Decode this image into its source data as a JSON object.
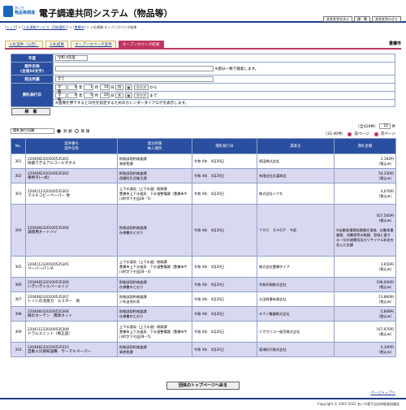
{
  "header": {
    "logo_line1": "あいち",
    "logo_line2": "物品等調達",
    "title": "電子調達共同システム（物品等）",
    "font_buttons": [
      "文字文字大きく",
      "標　準",
      "文字文字小さく"
    ]
  },
  "breadcrumb": {
    "items": [
      "トップ",
      "入札情報サービス（団体選択）",
      "豊橋市"
    ],
    "current": "入札情報-オープンカウンタ結果"
  },
  "tabs": [
    "入札案件（公告）",
    "入札結果",
    "オープンカウンタ案件",
    "オープンカウンタ結果"
  ],
  "city": "豊橋市",
  "form": {
    "year_label": "年度",
    "year_value": "令和 4年度",
    "subject_label": "案件名称",
    "subject_sub": "(全角50文字)",
    "subject_note": "※部分一致で検索します。",
    "dept_label": "発注所属",
    "dept_value": "全て",
    "date_label": "開札執行日",
    "from_era": "令和",
    "from_year": "4",
    "from_month": "1",
    "from_day": "10",
    "from_weekday": "月",
    "to_era": "令和",
    "to_year": "4",
    "to_month": "4",
    "to_day": "20",
    "to_weekday": "水",
    "unit_year": "年",
    "unit_month": "月",
    "unit_day": "日",
    "calendar_label": "クリア",
    "from_suffix": "から",
    "to_suffix": "まで",
    "date_note": "※画像を押下すると日付を指定するためのカレンダーダイアログを表示します。",
    "search_button": "検　索"
  },
  "sort": {
    "select_value": "開札執行日順",
    "asc_label": "昇 順",
    "desc_label": "降 順"
  },
  "pager": {
    "total": "（全429件）",
    "per_page": "10",
    "per_page_suffix": "件",
    "range": "（31-40件）",
    "prev": "前ページ",
    "next": "次ページ"
  },
  "table": {
    "headers": [
      "No.",
      "案件番号\n案件名称",
      "発注所属\n納入場所",
      "開札執行日",
      "業者名",
      "落札金額"
    ],
    "rows": [
      {
        "no": "301",
        "number": "2204082320100535301",
        "name": "除菌できるアルコールタオル",
        "dept": "財務部契約検査課",
        "place": "資産税課",
        "date": "令和 4年　4月20日",
        "vendor": "原田株式会社",
        "amount": "2,183円",
        "tax": "（税込み）"
      },
      {
        "no": "302",
        "number": "2204082320100535302",
        "name": "車椅子(一式)",
        "dept": "財務部契約検査課",
        "place": "保健所生活衛生課",
        "date": "令和 4年　4月20日",
        "vendor": "有限会社丸富商会",
        "amount": "54,230円",
        "tax": "（税込み）"
      },
      {
        "no": "303",
        "number": "2204112320100535303",
        "name": "マルチコピーペーパー 他",
        "dept": "上下水道局（上下水道）総務課",
        "place": "豊橋市上下水道局　下水道整備課（豊橋市牛川町字下モ田28－5）",
        "date": "令和 4年　4月20日",
        "vendor": "株式会社イクモ",
        "amount": "4,076円",
        "tax": "（税込み）"
      },
      {
        "no": "304",
        "number": "2204082320100535304",
        "name": "調達用オートバイ",
        "dept": "財務部契約検査課",
        "place": "仕様書のとおり",
        "date": "令和 4年　4月20日",
        "vendor": "ＹＯＵ　ＳＨＯＰ　今泉",
        "amount": "457,500円",
        "tax": "（税込み）",
        "note": "※自動車損害賠償責任保険、自動車重量税、消費税等の税額、登録に要する一切の諸費用及びリサイクル料金を含んだ金額"
      },
      {
        "no": "305",
        "number": "2204112320100535305",
        "name": "ペーパーパンチ",
        "dept": "上下水道局（上下水道）総務課",
        "place": "豊橋市上下水道局　下水道整備課（豊橋市牛川町字下モ田28－4）",
        "date": "令和 4年　4月20日",
        "vendor": "株式会社豊橋タイプ",
        "amount": "3,650円",
        "tax": "（税込み）"
      },
      {
        "no": "306",
        "number": "2204082320100535306",
        "name": "いきいきシルバーエイジ",
        "dept": "財務部契約検査課",
        "place": "仕様書のとおり",
        "date": "令和 4年　4月20日",
        "vendor": "共和印刷株式会社",
        "amount": "198,000円",
        "tax": "（税込み）"
      },
      {
        "no": "307",
        "number": "2204082320100535307",
        "name": "トイレの消臭力　エスター　他",
        "dept": "財務部契約検査課",
        "place": "少年自然の家",
        "date": "令和 4年　4月20日",
        "vendor": "久田商事有限会社",
        "amount": "13,860円",
        "tax": "（税込み）"
      },
      {
        "no": "308",
        "number": "2204082320100535308",
        "name": "緑のカーテン　簡単ネット",
        "dept": "財務部契約検査課",
        "place": "仕様書のとおり",
        "date": "令和 4年　4月20日",
        "vendor": "テクノ電器株式会社",
        "amount": "5,808円",
        "tax": "（税込み）"
      },
      {
        "no": "309",
        "number": "2204112320100535309",
        "name": "ドラムユニット（純正品）",
        "dept": "上下水道局（上下水道）総務課",
        "place": "豊橋市上下水道局　下水道整備課（豊橋市牛川町字下モ田28－5）",
        "date": "令和 4年　4月20日",
        "vendor": "ミカワリコー販売株式会社",
        "amount": "167,970円",
        "tax": "（税込み）"
      },
      {
        "no": "310",
        "number": "2204082320100535310",
        "name": "自動火災報知設備　サーマルペーパー",
        "dept": "財務部契約検査課",
        "place": "資産税課",
        "date": "令和 4年　4月20日",
        "vendor": "東海防災株式会社",
        "amount": "6,300円",
        "tax": "（税込み）"
      }
    ]
  },
  "bottom_button": "団体のトップページへ戻る",
  "to_top": "ページトップへ",
  "footer": "Copyright © 2007-2022 あいち電子自治体推進協議会"
}
